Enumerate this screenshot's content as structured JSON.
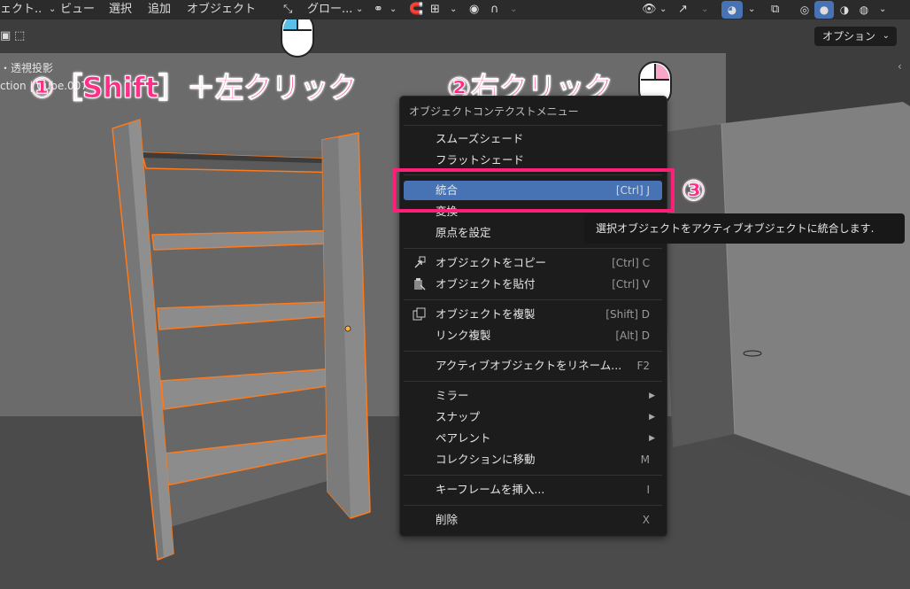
{
  "header": {
    "menus": [
      "ェクト..",
      "ビュー",
      "選択",
      "追加",
      "オブジェクト"
    ],
    "transform_orientation": "グロー...",
    "options_label": "オプション"
  },
  "overlay": {
    "view_label": "・透視投影",
    "collection_label": "ction | Cube.007"
  },
  "annotations": {
    "step1": "①［Shift］＋左クリック",
    "step2": "②右クリック",
    "step3": "③"
  },
  "context_menu": {
    "title": "オブジェクトコンテクストメニュー",
    "items": [
      {
        "label": "スムーズシェード",
        "shortcut": ""
      },
      {
        "label": "フラットシェード",
        "shortcut": ""
      },
      {
        "label": "統合",
        "shortcut": "[Ctrl] J"
      },
      {
        "label": "変換",
        "shortcut": ""
      },
      {
        "label": "原点を設定",
        "shortcut": ""
      },
      {
        "label": "オブジェクトをコピー",
        "shortcut": "[Ctrl] C"
      },
      {
        "label": "オブジェクトを貼付",
        "shortcut": "[Ctrl] V"
      },
      {
        "label": "オブジェクトを複製",
        "shortcut": "[Shift] D"
      },
      {
        "label": "リンク複製",
        "shortcut": "[Alt] D"
      },
      {
        "label": "アクティブオブジェクトをリネーム...",
        "shortcut": "F2"
      },
      {
        "label": "ミラー",
        "shortcut": ""
      },
      {
        "label": "スナップ",
        "shortcut": ""
      },
      {
        "label": "ペアレント",
        "shortcut": ""
      },
      {
        "label": "コレクションに移動",
        "shortcut": "M"
      },
      {
        "label": "キーフレームを挿入...",
        "shortcut": "I"
      },
      {
        "label": "削除",
        "shortcut": "X"
      }
    ]
  },
  "tooltip": {
    "text": "選択オブジェクトをアクティブオブジェクトに統合します."
  },
  "colors": {
    "highlight": "#4772b3",
    "annotation": "#ff2e86",
    "selection_outline": "#ff7a1a"
  }
}
